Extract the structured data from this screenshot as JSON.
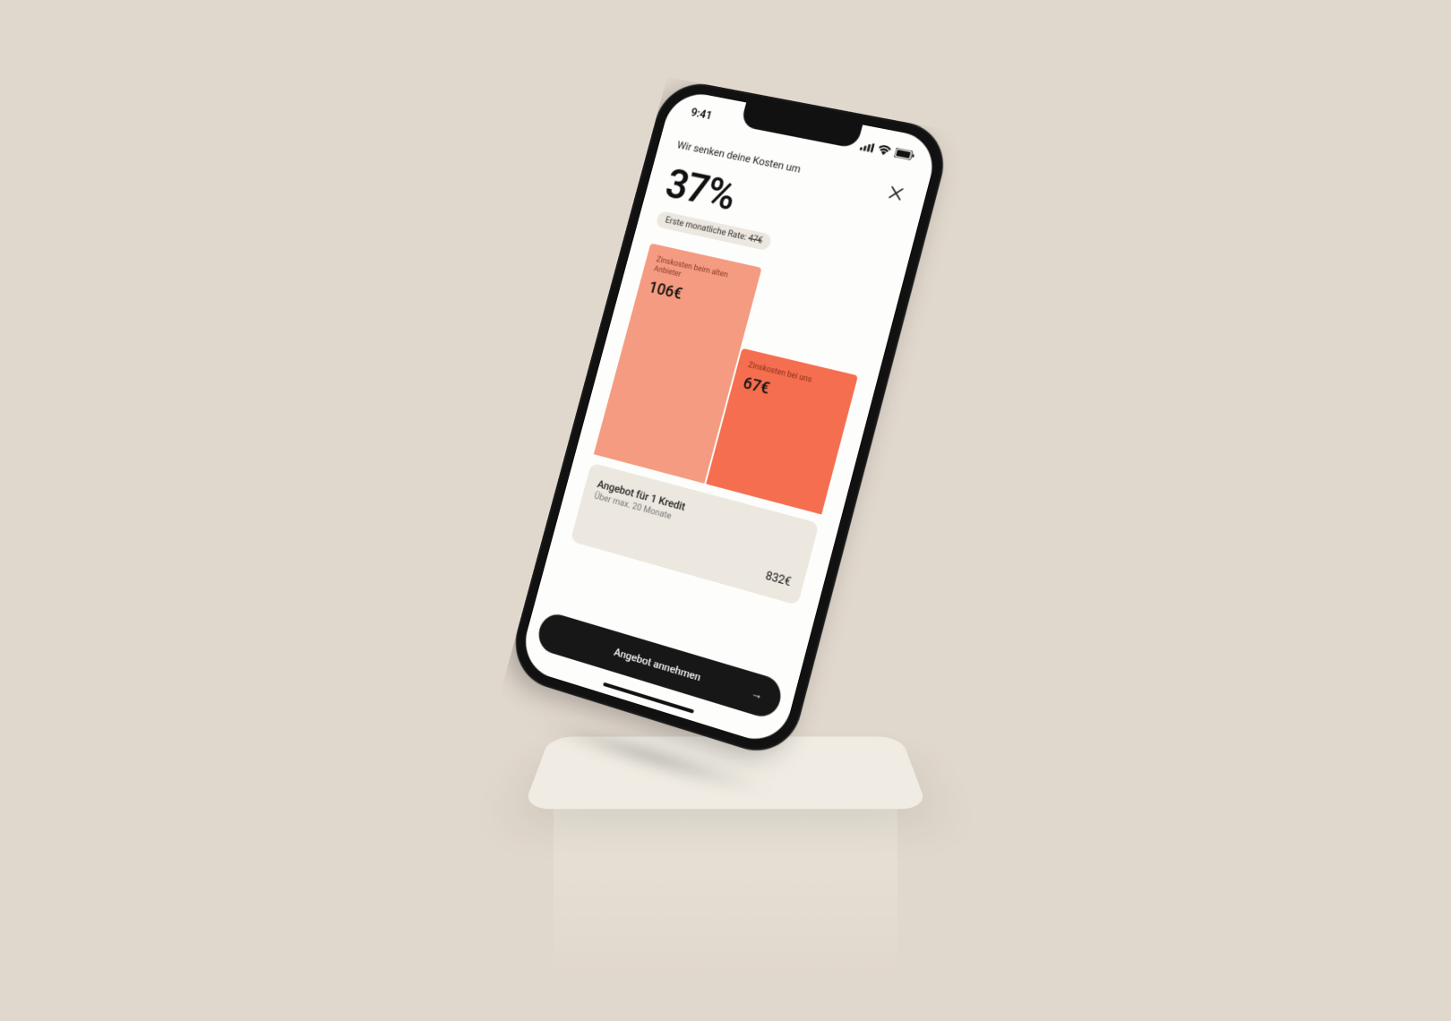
{
  "status": {
    "time": "9:41",
    "icons": {
      "signal": "signal-icon",
      "wifi": "wifi-icon",
      "battery": "battery-icon"
    }
  },
  "header": {
    "subtitle": "Wir senken deine Kosten um",
    "percent": "37%",
    "chip_prefix": "Erste monatliche Rate: ",
    "chip_strike": "47€"
  },
  "chart_data": {
    "type": "bar",
    "categories": [
      "Zinskosten beim alten Anbieter",
      "Zinskosten bei uns"
    ],
    "values": [
      106,
      67
    ],
    "title": "",
    "xlabel": "",
    "ylabel": "",
    "ylim": [
      0,
      106
    ]
  },
  "chart_display": {
    "old": {
      "label": "Zinskosten beim alten Anbieter",
      "value": "106€"
    },
    "new": {
      "label": "Zinskosten bei uns",
      "value": "67€"
    }
  },
  "offer": {
    "title": "Angebot für 1 Kredit",
    "sub": "Über max. 20 Monate",
    "amount": "832€"
  },
  "cta": {
    "label": "Angebot annehmen",
    "arrow": "→"
  },
  "colors": {
    "bg": "#e1d8cd",
    "bar_old": "#f59b81",
    "bar_new": "#f46e4f",
    "chip_bg": "#ece7df",
    "cta_bg": "#171717"
  }
}
